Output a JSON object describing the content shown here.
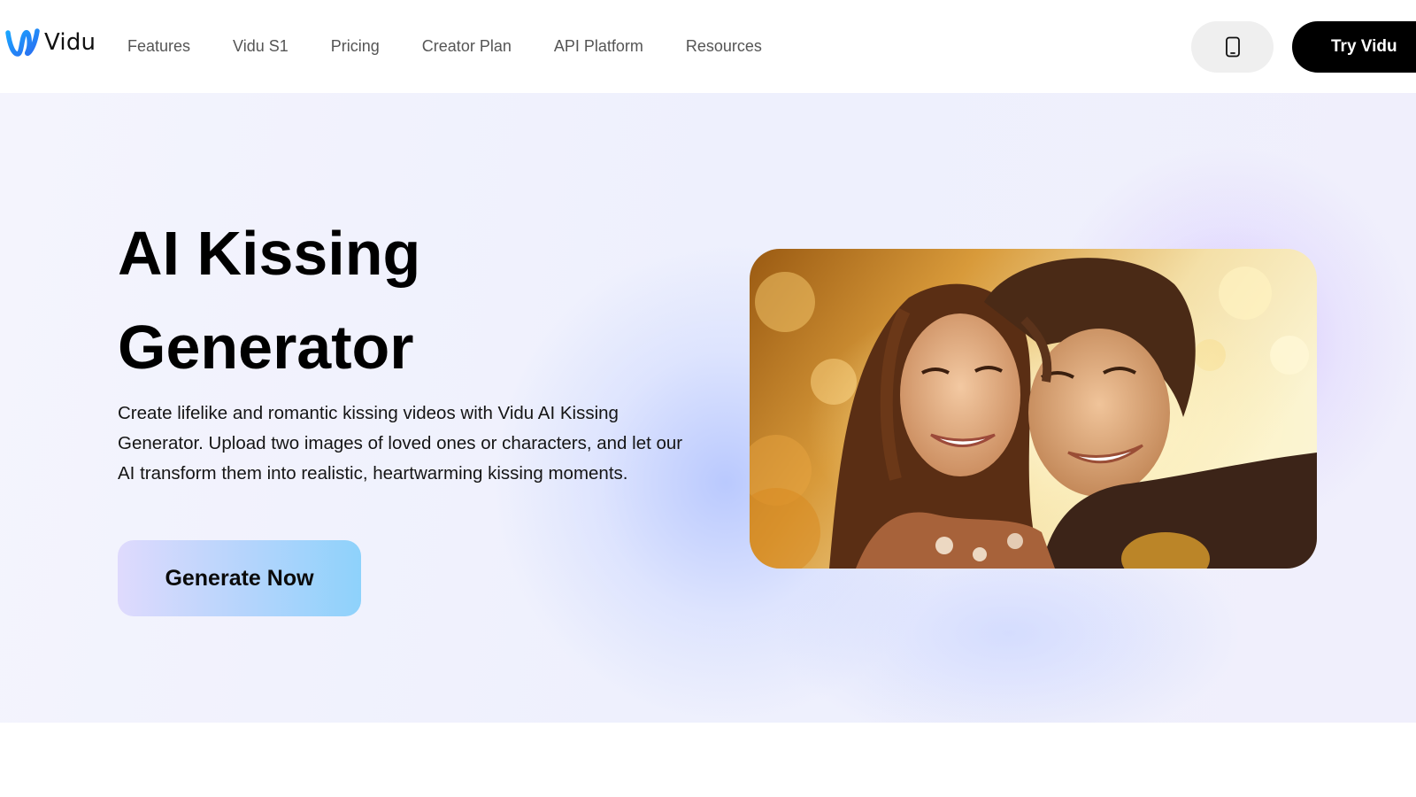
{
  "brand": {
    "name": "Vidu",
    "logo_icon": "vidu-wave-logo"
  },
  "nav": {
    "items": [
      {
        "label": "Features"
      },
      {
        "label": "Vidu S1"
      },
      {
        "label": "Pricing"
      },
      {
        "label": "Creator Plan"
      },
      {
        "label": "API Platform"
      },
      {
        "label": "Resources"
      }
    ]
  },
  "header": {
    "mobile_icon": "mobile-phone-icon",
    "cta_label": "Try Vidu"
  },
  "hero": {
    "title_line1": "AI Kissing",
    "title_line2": "Generator",
    "description": "Create lifelike and romantic kissing videos with Vidu AI Kissing Generator. Upload two images of loved ones or characters, and let our AI transform them into realistic, heartwarming kissing moments.",
    "cta_label": "Generate Now",
    "image": "smiling-young-couple-photo"
  },
  "colors": {
    "accent_dark": "#000000",
    "logo_blue": "#2f8cf0",
    "cta_gradient_start": "#dfdafd",
    "cta_gradient_end": "#8ed2fb"
  }
}
